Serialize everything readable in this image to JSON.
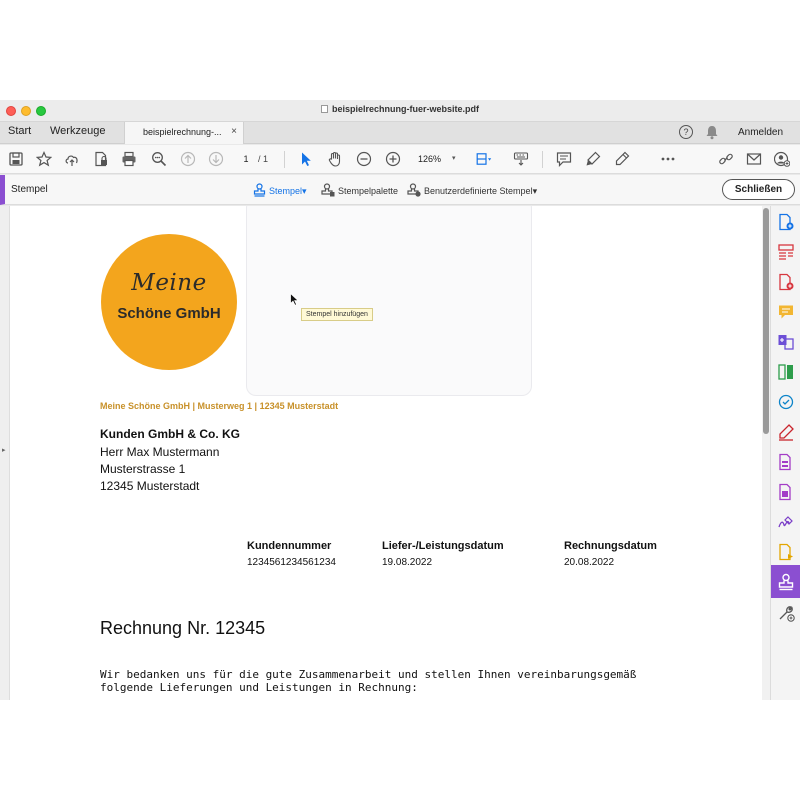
{
  "window": {
    "document_title": "beispielrechnung-fuer-website.pdf"
  },
  "tabs": {
    "home": "Start",
    "tools": "Werkzeuge",
    "document": "beispielrechnung-...",
    "close_glyph": "×"
  },
  "account": {
    "help_glyph": "?",
    "sign_in": "Anmelden"
  },
  "toolbar": {
    "page_current": "1",
    "page_total": "/ 1",
    "zoom": "126%",
    "zoom_caret": "▾"
  },
  "stamp_toolbar": {
    "title": "Stempel",
    "stamp": "Stempel",
    "stamp_caret": "▾",
    "palette": "Stempelpalette",
    "custom": "Benutzerdefinierte Stempel",
    "custom_caret": "▾",
    "close": "Schließen",
    "tooltip": "Stempel hinzufügen"
  },
  "document": {
    "logo_script": "Meine",
    "logo_company": "Schöne GmbH",
    "sender_line": "Meine Schöne GmbH | Musterweg 1 | 12345 Musterstadt",
    "recipient": {
      "company": "Kunden GmbH & Co. KG",
      "person": "Herr Max Mustermann",
      "street": "Musterstrasse 1",
      "city": "12345 Musterstadt"
    },
    "meta": {
      "customer_no_label": "Kundennummer",
      "customer_no": "1234561234561234",
      "delivery_label": "Liefer-/Leistungsdatum",
      "delivery_date": "19.08.2022",
      "invoice_date_label": "Rechnungsdatum",
      "invoice_date": "20.08.2022"
    },
    "invoice_title": "Rechnung Nr. 12345",
    "intro_line1": "Wir bedanken uns für die gute Zusammenarbeit und stellen Ihnen vereinbarungsgemäß",
    "intro_line2": "folgende Lieferungen und Leistungen in Rechnung:"
  },
  "colors": {
    "accent_purple": "#8b4fd1",
    "link_blue": "#1473e6",
    "logo_orange": "#f3a51d",
    "sender_gold": "#c8912a"
  }
}
